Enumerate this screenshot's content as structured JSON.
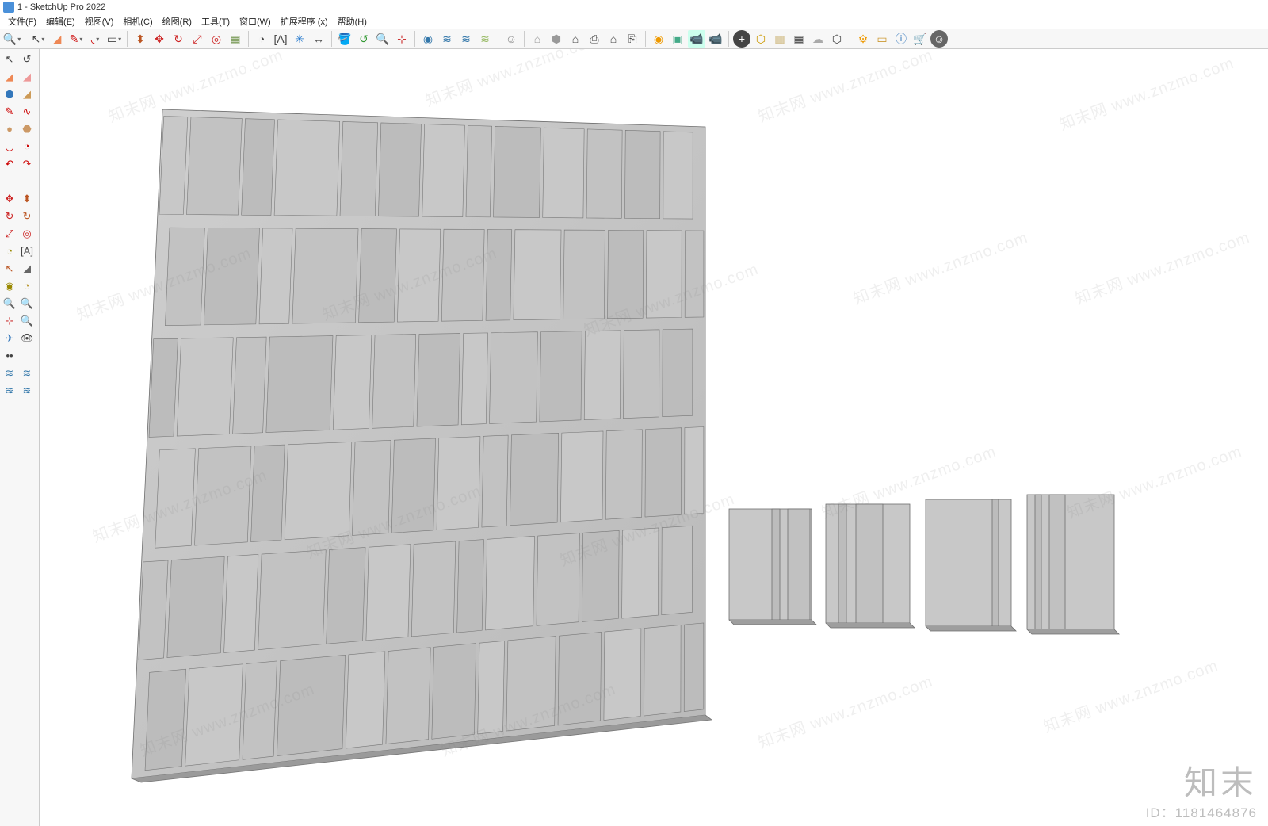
{
  "title": "1 - SketchUp Pro 2022",
  "menu": [
    "文件(F)",
    "编辑(E)",
    "视图(V)",
    "相机(C)",
    "绘图(R)",
    "工具(T)",
    "窗口(W)",
    "扩展程序 (x)",
    "帮助(H)"
  ],
  "brand": {
    "name": "知末",
    "id": "ID：1181464876"
  },
  "watermark": "知末网 www.znzmo.com",
  "topIcons": [
    {
      "n": "zoom-icon",
      "g": "🔍",
      "d": 1
    },
    {
      "sep": 1
    },
    {
      "n": "select-icon",
      "g": "↖",
      "d": 1
    },
    {
      "n": "eraser-icon",
      "g": "◢",
      "c": "#e85"
    },
    {
      "n": "pencil-icon",
      "g": "✎",
      "c": "#c00",
      "d": 1
    },
    {
      "n": "arc-icon",
      "g": "◟",
      "c": "#c00",
      "d": 1
    },
    {
      "n": "rect-icon",
      "g": "▭",
      "d": 1
    },
    {
      "sep": 1
    },
    {
      "n": "pushpull-icon",
      "g": "⬍",
      "c": "#b52"
    },
    {
      "n": "move-icon",
      "g": "✥",
      "c": "#c22"
    },
    {
      "n": "rotate-icon",
      "g": "↻",
      "c": "#c22"
    },
    {
      "n": "scale-icon",
      "g": "⤢",
      "c": "#c22"
    },
    {
      "n": "offset-icon",
      "g": "◎",
      "c": "#c22"
    },
    {
      "n": "tape-icon",
      "g": "▦",
      "c": "#795"
    },
    {
      "sep": 1
    },
    {
      "n": "protractor-icon",
      "g": "◔"
    },
    {
      "n": "text-icon",
      "g": "[A]"
    },
    {
      "n": "axes-icon",
      "g": "✳",
      "c": "#27c"
    },
    {
      "n": "dim-icon",
      "g": "↔"
    },
    {
      "sep": 1
    },
    {
      "n": "paint-icon",
      "g": "🪣",
      "c": "#b60"
    },
    {
      "n": "orbit-icon",
      "g": "↺",
      "c": "#393"
    },
    {
      "n": "pan-icon",
      "g": "🔍"
    },
    {
      "n": "zoomext-icon",
      "g": "⊹",
      "c": "#c33"
    },
    {
      "sep": 1
    },
    {
      "n": "section-icon",
      "g": "◉",
      "c": "#37a"
    },
    {
      "n": "layers-icon",
      "g": "≋",
      "c": "#37a"
    },
    {
      "n": "outliner-icon",
      "g": "≋",
      "c": "#37a"
    },
    {
      "n": "styles-icon",
      "g": "≋",
      "c": "#9b6"
    },
    {
      "sep": 1
    },
    {
      "n": "user-icon",
      "g": "☺",
      "c": "#888"
    },
    {
      "sep": 1
    },
    {
      "n": "warehouse-icon",
      "g": "⌂",
      "c": "#999"
    },
    {
      "n": "3dw-icon",
      "g": "⬢",
      "c": "#999"
    },
    {
      "n": "home-icon",
      "g": "⌂"
    },
    {
      "n": "print-icon",
      "g": "⎙"
    },
    {
      "n": "export-icon",
      "g": "⌂"
    },
    {
      "n": "import-icon",
      "g": "⎘"
    },
    {
      "sep": 1
    },
    {
      "n": "geolocation-icon",
      "g": "◉",
      "c": "#e90"
    },
    {
      "n": "match-icon",
      "g": "▣",
      "c": "#4a8"
    },
    {
      "n": "camera-icon",
      "g": "📹",
      "c": "#888",
      "bg": "#cfe"
    },
    {
      "n": "record-icon",
      "g": "📹",
      "c": "#888"
    },
    {
      "sep": 1
    },
    {
      "n": "add-icon",
      "g": "+",
      "c": "#fff",
      "bg": "#444",
      "r": 1
    },
    {
      "n": "box-icon",
      "g": "⬡",
      "c": "#c90"
    },
    {
      "n": "report-icon",
      "g": "▥",
      "c": "#b94"
    },
    {
      "n": "grid-icon",
      "g": "▦"
    },
    {
      "n": "fog-icon",
      "g": "☁",
      "c": "#aaa"
    },
    {
      "n": "sun-icon",
      "g": "⬡"
    },
    {
      "sep": 1
    },
    {
      "n": "gear-icon",
      "g": "⚙",
      "c": "#e90"
    },
    {
      "n": "settings-icon",
      "g": "▭",
      "c": "#c93"
    },
    {
      "n": "info-icon",
      "g": "ⓘ",
      "c": "#37b"
    },
    {
      "n": "cart-icon",
      "g": "🛒"
    },
    {
      "n": "profile-icon",
      "g": "☺",
      "c": "#fff",
      "bg": "#666",
      "r": 1
    }
  ],
  "leftIcons": [
    {
      "n": "select-icon",
      "g": "↖"
    },
    {
      "n": "orbit-icon",
      "g": "↺"
    },
    {
      "n": "lasso-icon",
      "g": "◢",
      "c": "#e85"
    },
    {
      "n": "eraser-icon",
      "g": "◢",
      "c": "#e99"
    },
    {
      "n": "component-icon",
      "g": "⬢",
      "c": "#37b"
    },
    {
      "n": "paint-icon",
      "g": "◢",
      "c": "#c95"
    },
    {
      "n": "line-icon",
      "g": "✎",
      "c": "#c00"
    },
    {
      "n": "free-icon",
      "g": "∿",
      "c": "#c00"
    },
    {
      "n": "circle-icon",
      "g": "●",
      "c": "#c96"
    },
    {
      "n": "polygon-icon",
      "g": "⬣",
      "c": "#c96"
    },
    {
      "n": "arc-icon",
      "g": "◡",
      "c": "#c00"
    },
    {
      "n": "pie-icon",
      "g": "◔",
      "c": "#c00"
    },
    {
      "n": "undo-icon",
      "g": "↶",
      "c": "#c00"
    },
    {
      "n": "redo-icon",
      "g": "↷",
      "c": "#c00"
    },
    {
      "n": "blank1",
      "g": ""
    },
    {
      "n": "blank2",
      "g": ""
    },
    {
      "n": "move-icon",
      "g": "✥",
      "c": "#c22"
    },
    {
      "n": "pushpull-icon",
      "g": "⬍",
      "c": "#b52"
    },
    {
      "n": "rotate-icon",
      "g": "↻",
      "c": "#c22"
    },
    {
      "n": "follow-icon",
      "g": "↻",
      "c": "#b52"
    },
    {
      "n": "scale-icon",
      "g": "⤢",
      "c": "#c22"
    },
    {
      "n": "offset-icon",
      "g": "◎",
      "c": "#c22"
    },
    {
      "n": "tape-icon",
      "g": "◔",
      "c": "#980"
    },
    {
      "n": "dim-icon",
      "g": "[A]"
    },
    {
      "n": "protractor-icon",
      "g": "↖",
      "c": "#b52"
    },
    {
      "n": "text-icon",
      "g": "◢",
      "c": "#666"
    },
    {
      "n": "axes-icon",
      "g": "◉",
      "c": "#980"
    },
    {
      "n": "section-icon",
      "g": "◔",
      "c": "#b93"
    },
    {
      "n": "zoom-icon",
      "g": "🔍"
    },
    {
      "n": "zoomw-icon",
      "g": "🔍",
      "c": "#c33"
    },
    {
      "n": "pos-icon",
      "g": "⊹",
      "c": "#c33"
    },
    {
      "n": "look-icon",
      "g": "🔍"
    },
    {
      "n": "walk-icon",
      "g": "✈",
      "c": "#37b"
    },
    {
      "n": "eye-icon",
      "g": "👁"
    },
    {
      "n": "steps-icon",
      "g": "••"
    },
    {
      "n": "blank3",
      "g": ""
    },
    {
      "n": "layers-icon",
      "g": "≋",
      "c": "#37a"
    },
    {
      "n": "styles-icon",
      "g": "≋",
      "c": "#37a"
    },
    {
      "n": "tags-icon",
      "g": "≋",
      "c": "#37a"
    },
    {
      "n": "soften-icon",
      "g": "≋",
      "c": "#37a"
    }
  ]
}
